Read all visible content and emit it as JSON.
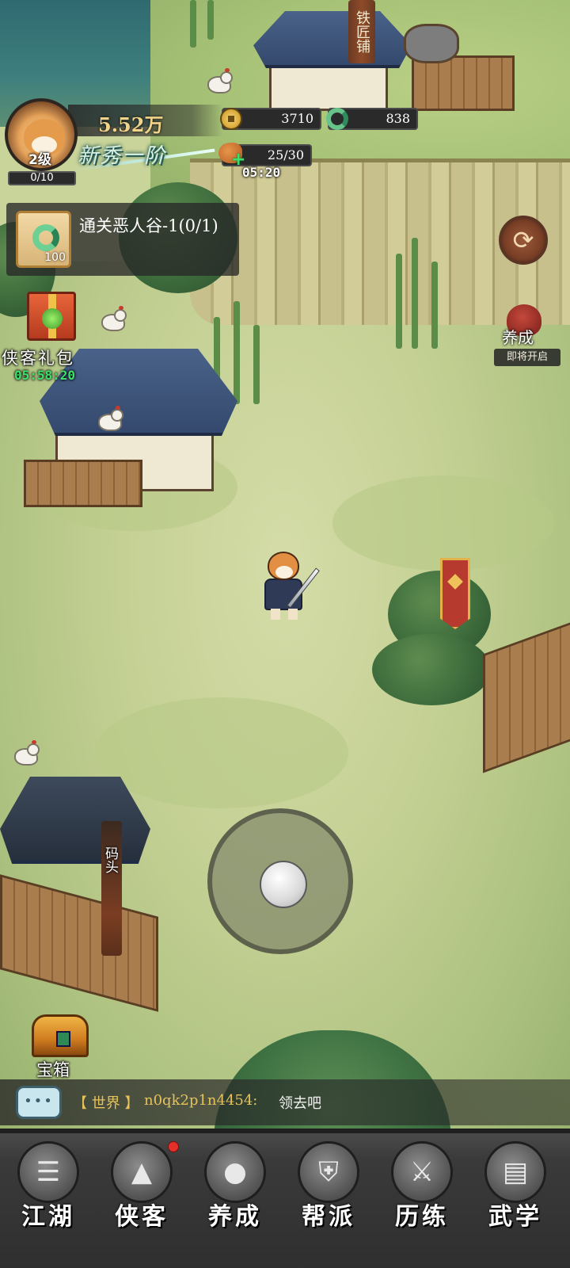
{
  "player": {
    "power": "5.52万",
    "level": "2级",
    "exp": "0/10",
    "rank_title": "新秀一阶"
  },
  "resources": {
    "coins": "3710",
    "jade": "838",
    "stamina": "25/30",
    "stamina_timer": "05:20"
  },
  "quest": {
    "text": "通关恶人谷-1(0/1)",
    "reward_count": "100"
  },
  "gift_pack": {
    "label": "侠客礼包",
    "timer": "05:58:20"
  },
  "cultivate_event": {
    "label": "养成",
    "subtitle": "即将开启"
  },
  "map_signs": {
    "smithy": "铁匠铺",
    "dock": "码头"
  },
  "treasure_chest": {
    "label": "宝箱"
  },
  "chat": {
    "channel": "【 世界 】",
    "user": "n0qk2p1n4454:",
    "message": "领去吧"
  },
  "nav": [
    {
      "label": "江湖",
      "icon": "map-scroll-icon",
      "badge": false
    },
    {
      "label": "侠客",
      "icon": "hero-hat-icon",
      "badge": true
    },
    {
      "label": "养成",
      "icon": "cannon-icon",
      "badge": false
    },
    {
      "label": "帮派",
      "icon": "armor-icon",
      "badge": false
    },
    {
      "label": "历练",
      "icon": "blade-icon",
      "badge": false
    },
    {
      "label": "武学",
      "icon": "book-icon",
      "badge": false
    }
  ],
  "colors": {
    "gold_text": "#f2d38a",
    "timer_green": "#3de06a",
    "chat_gold": "#e6c25c",
    "badge_red": "#e3302a"
  }
}
